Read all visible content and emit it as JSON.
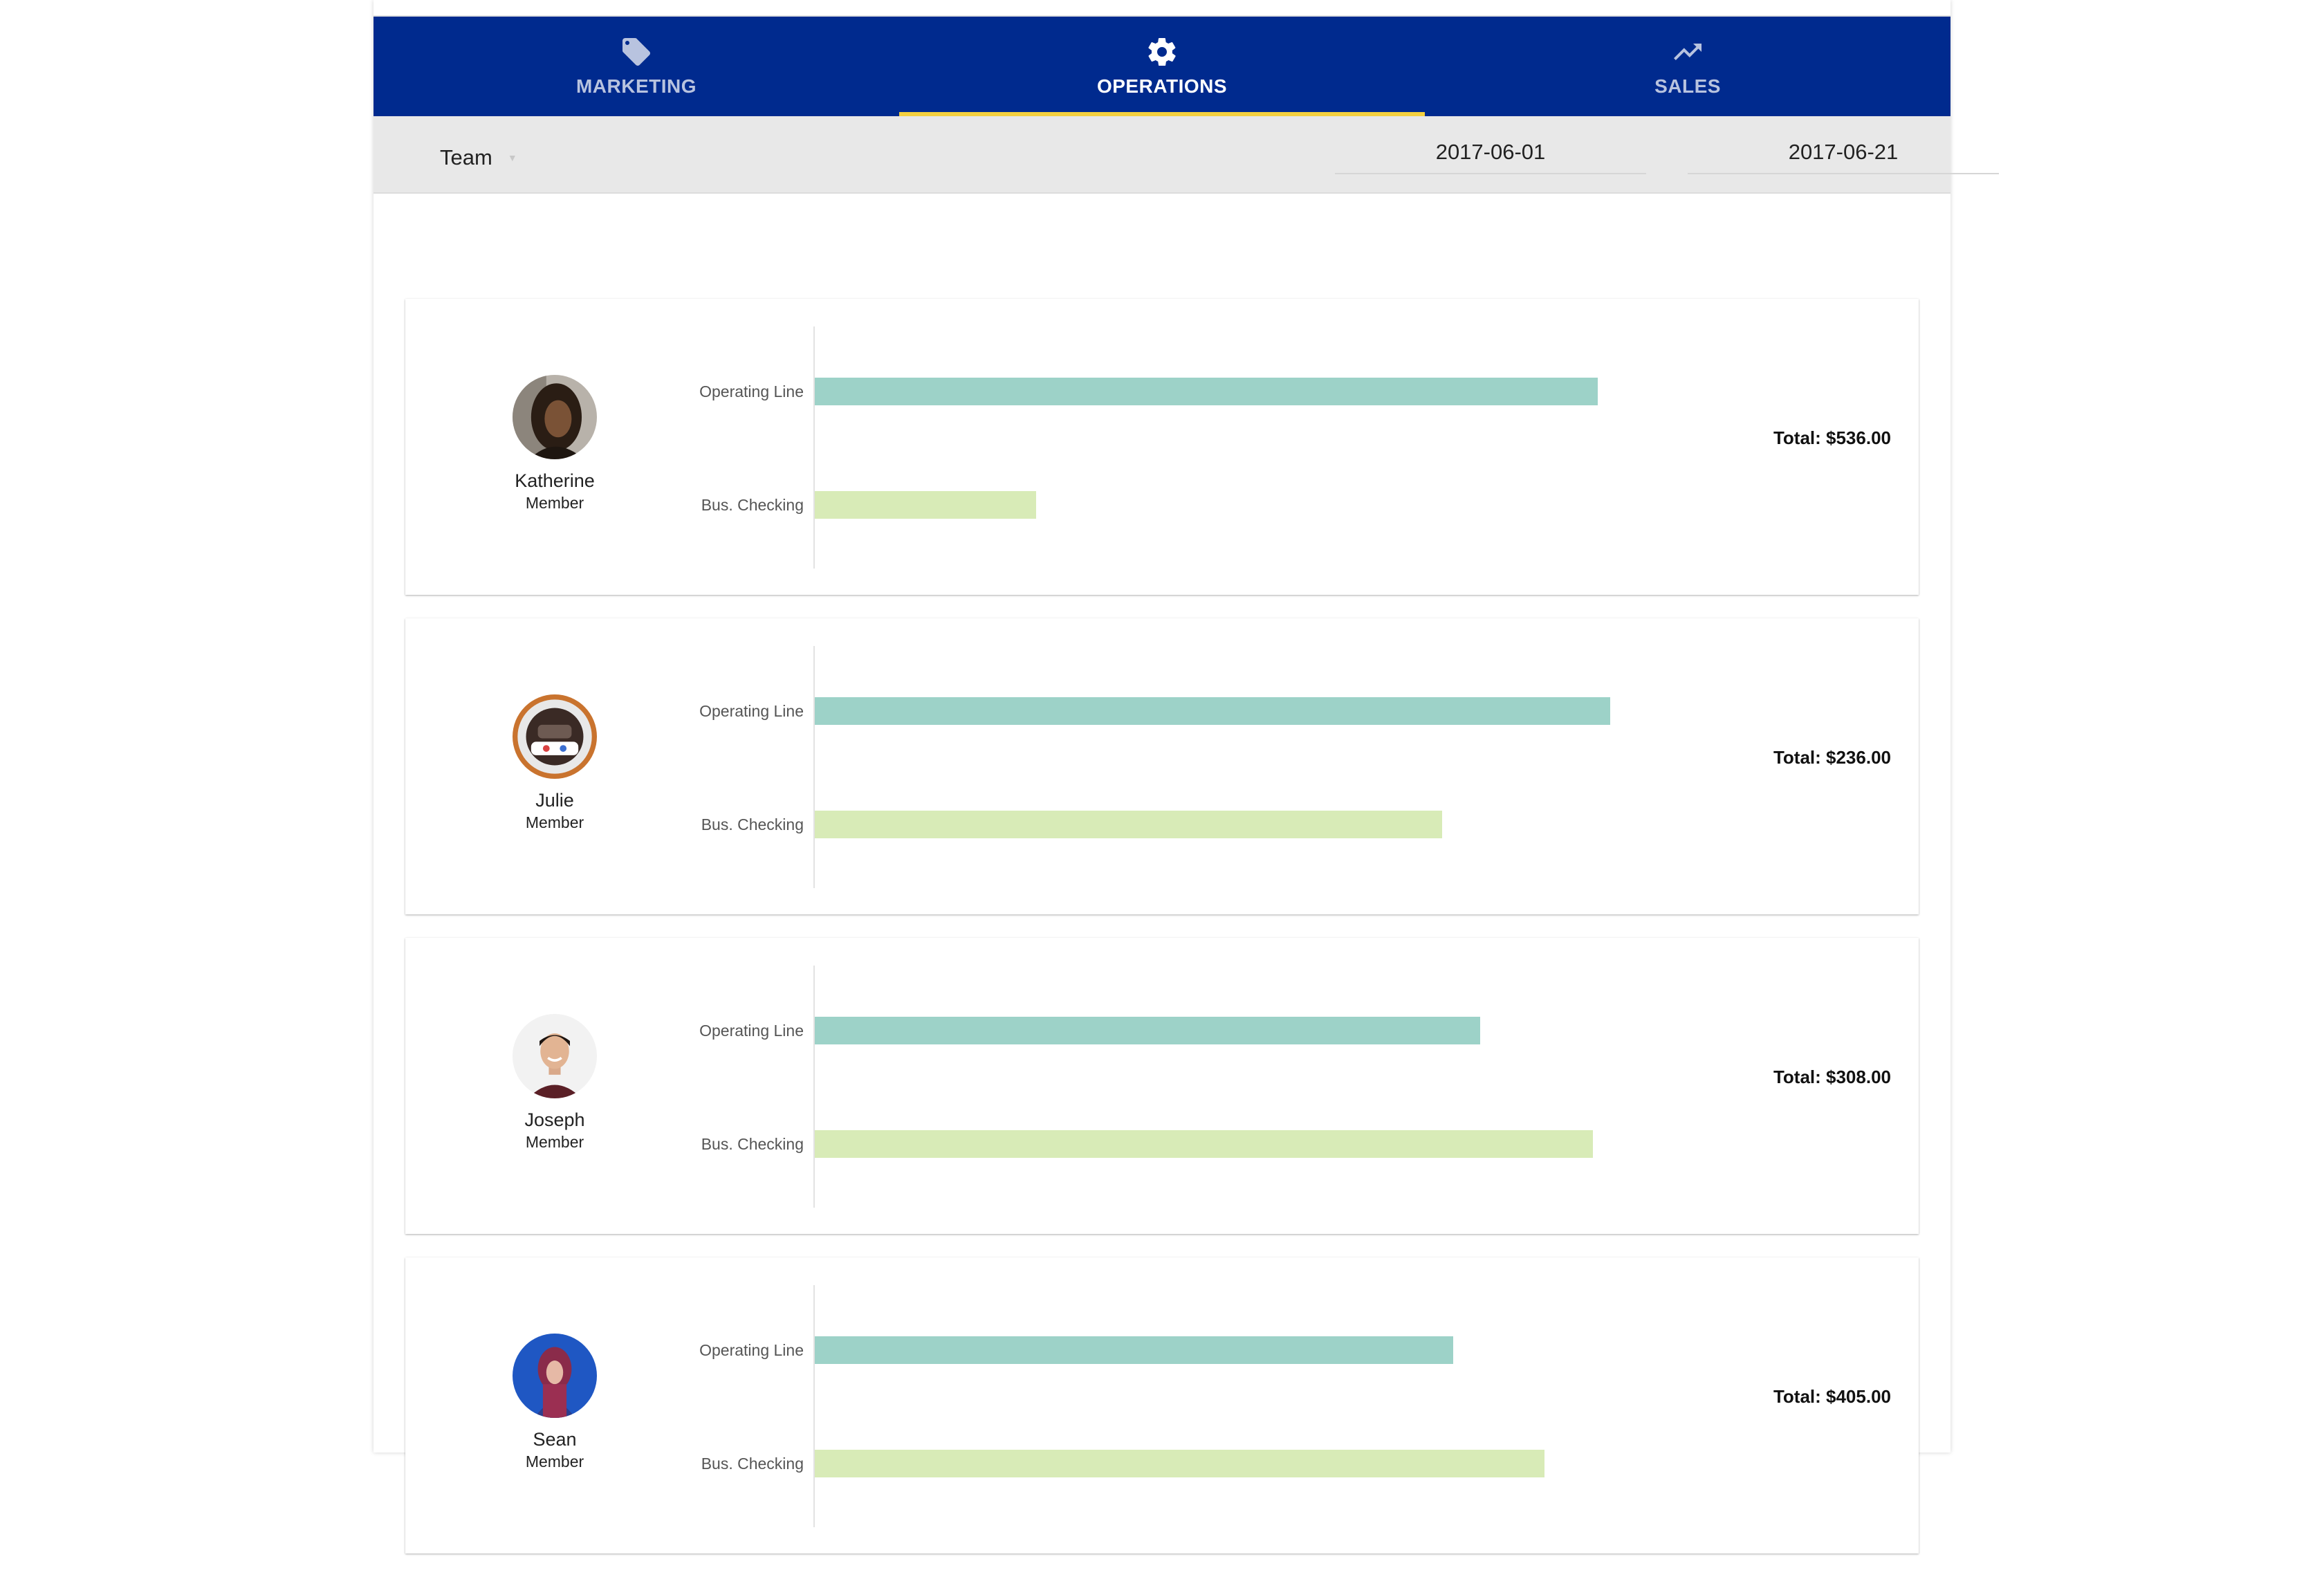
{
  "tabs": [
    {
      "label": "MARKETING",
      "icon": "tag-icon",
      "active": false
    },
    {
      "label": "OPERATIONS",
      "icon": "gear-icon",
      "active": true
    },
    {
      "label": "SALES",
      "icon": "trending-up-icon",
      "active": false
    }
  ],
  "filters": {
    "team_label": "Team",
    "start_date": "2017-06-01",
    "end_date": "2017-06-21"
  },
  "colors": {
    "tabbar": "#002a8e",
    "indicator": "#f4d03f",
    "operating_line": "#9dd2c8",
    "bus_checking": "#d8ebb7"
  },
  "members": [
    {
      "name": "Katherine",
      "role": "Member",
      "total": "Total: $536.00"
    },
    {
      "name": "Julie",
      "role": "Member",
      "total": "Total: $236.00"
    },
    {
      "name": "Joseph",
      "role": "Member",
      "total": "Total: $308.00"
    },
    {
      "name": "Sean",
      "role": "Member",
      "total": "Total: $405.00"
    }
  ],
  "chart_data": [
    {
      "type": "bar",
      "orientation": "horizontal",
      "categories": [
        "Operating Line",
        "Bus. Checking"
      ],
      "values": [
        0.92,
        0.26
      ],
      "value_unit": "fraction of max bar length"
    },
    {
      "type": "bar",
      "orientation": "horizontal",
      "categories": [
        "Operating Line",
        "Bus. Checking"
      ],
      "values": [
        0.935,
        0.737
      ],
      "value_unit": "fraction of max bar length"
    },
    {
      "type": "bar",
      "orientation": "horizontal",
      "categories": [
        "Operating Line",
        "Bus. Checking"
      ],
      "values": [
        0.782,
        0.915
      ],
      "value_unit": "fraction of max bar length"
    },
    {
      "type": "bar",
      "orientation": "horizontal",
      "categories": [
        "Operating Line",
        "Bus. Checking"
      ],
      "values": [
        0.75,
        0.858
      ],
      "value_unit": "fraction of max bar length"
    }
  ]
}
